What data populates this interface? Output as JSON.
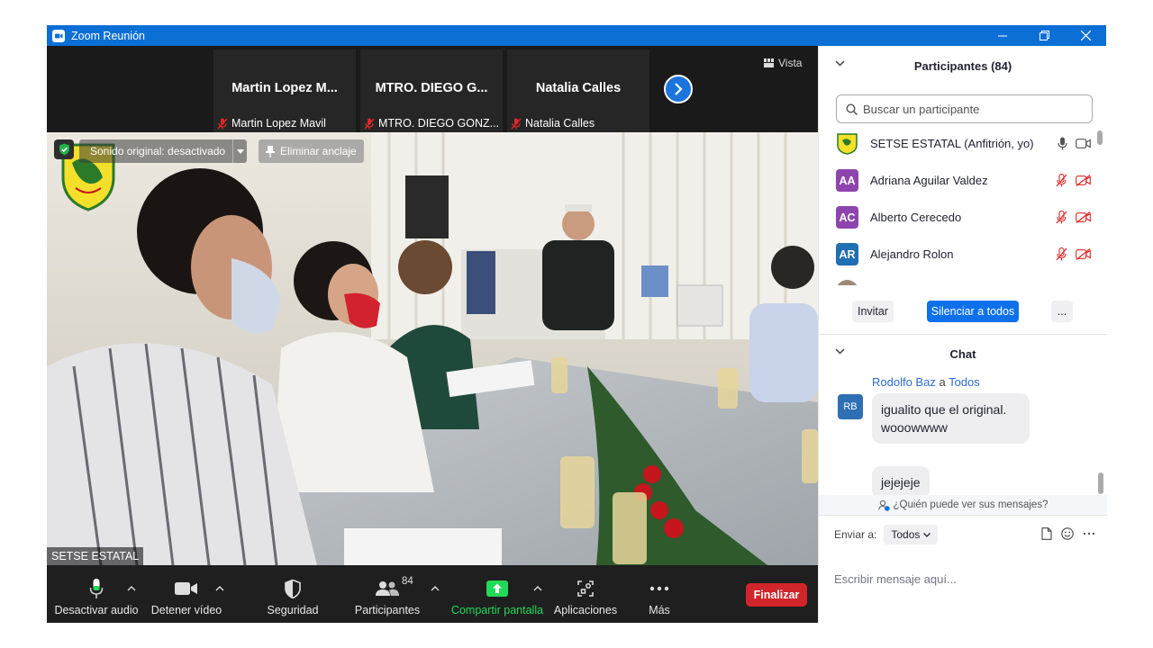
{
  "window": {
    "title": "Zoom Reunión",
    "title_color": "#0b6fd6"
  },
  "strip": {
    "tiles": [
      {
        "name": "Martin Lopez M...",
        "label": "Martin Lopez Mavil"
      },
      {
        "name": "MTRO. DIEGO G...",
        "label": "MTRO. DIEGO GONZ..."
      },
      {
        "name": "Natalia Calles",
        "label": "Natalia Calles"
      }
    ],
    "view_label": "Vista"
  },
  "video": {
    "sound_label": "Sonido original: desactivado",
    "unpin_label": "Eliminar anclaje",
    "speaker_name": "SETSE ESTATAL"
  },
  "toolbar": {
    "mute_label": "Desactivar audio",
    "video_label": "Detener vídeo",
    "security_label": "Seguridad",
    "participants_label": "Participantes",
    "participants_count": "84",
    "share_label": "Compartir pantalla",
    "apps_label": "Aplicaciones",
    "more_label": "Más",
    "end_label": "Finalizar",
    "end_color": "#d1252c",
    "share_color": "#23d959"
  },
  "participants": {
    "header": "Participantes (84)",
    "search_placeholder": "Buscar un participante",
    "list": [
      {
        "name": "SETSE ESTATAL (Anfitrión, yo)",
        "initials": "",
        "color": ""
      },
      {
        "name": "Adriana Aguilar Valdez",
        "initials": "AA",
        "color": "#8e44ad"
      },
      {
        "name": "Alberto Cerecedo",
        "initials": "AC",
        "color": "#8e44ad"
      },
      {
        "name": "Alejandro Rolon",
        "initials": "AR",
        "color": "#1f6fb3"
      }
    ],
    "invite_label": "Invitar",
    "mute_all_label": "Silenciar a todos",
    "more_label": "..."
  },
  "chat": {
    "header": "Chat",
    "sender": "Rodolfo Baz",
    "to_word": "a",
    "recipient": "Todos",
    "sender_initials": "RB",
    "messages": [
      {
        "line1": "igualito que el original.",
        "line2": "wooowwww"
      },
      {
        "line1": "jejejeje",
        "line2": ""
      }
    ],
    "who_sees": "¿Quién puede ver sus mensajes?",
    "send_to_label": "Enviar a:",
    "send_to_value": "Todos",
    "input_placeholder": "Escribir mensaje aquí..."
  }
}
